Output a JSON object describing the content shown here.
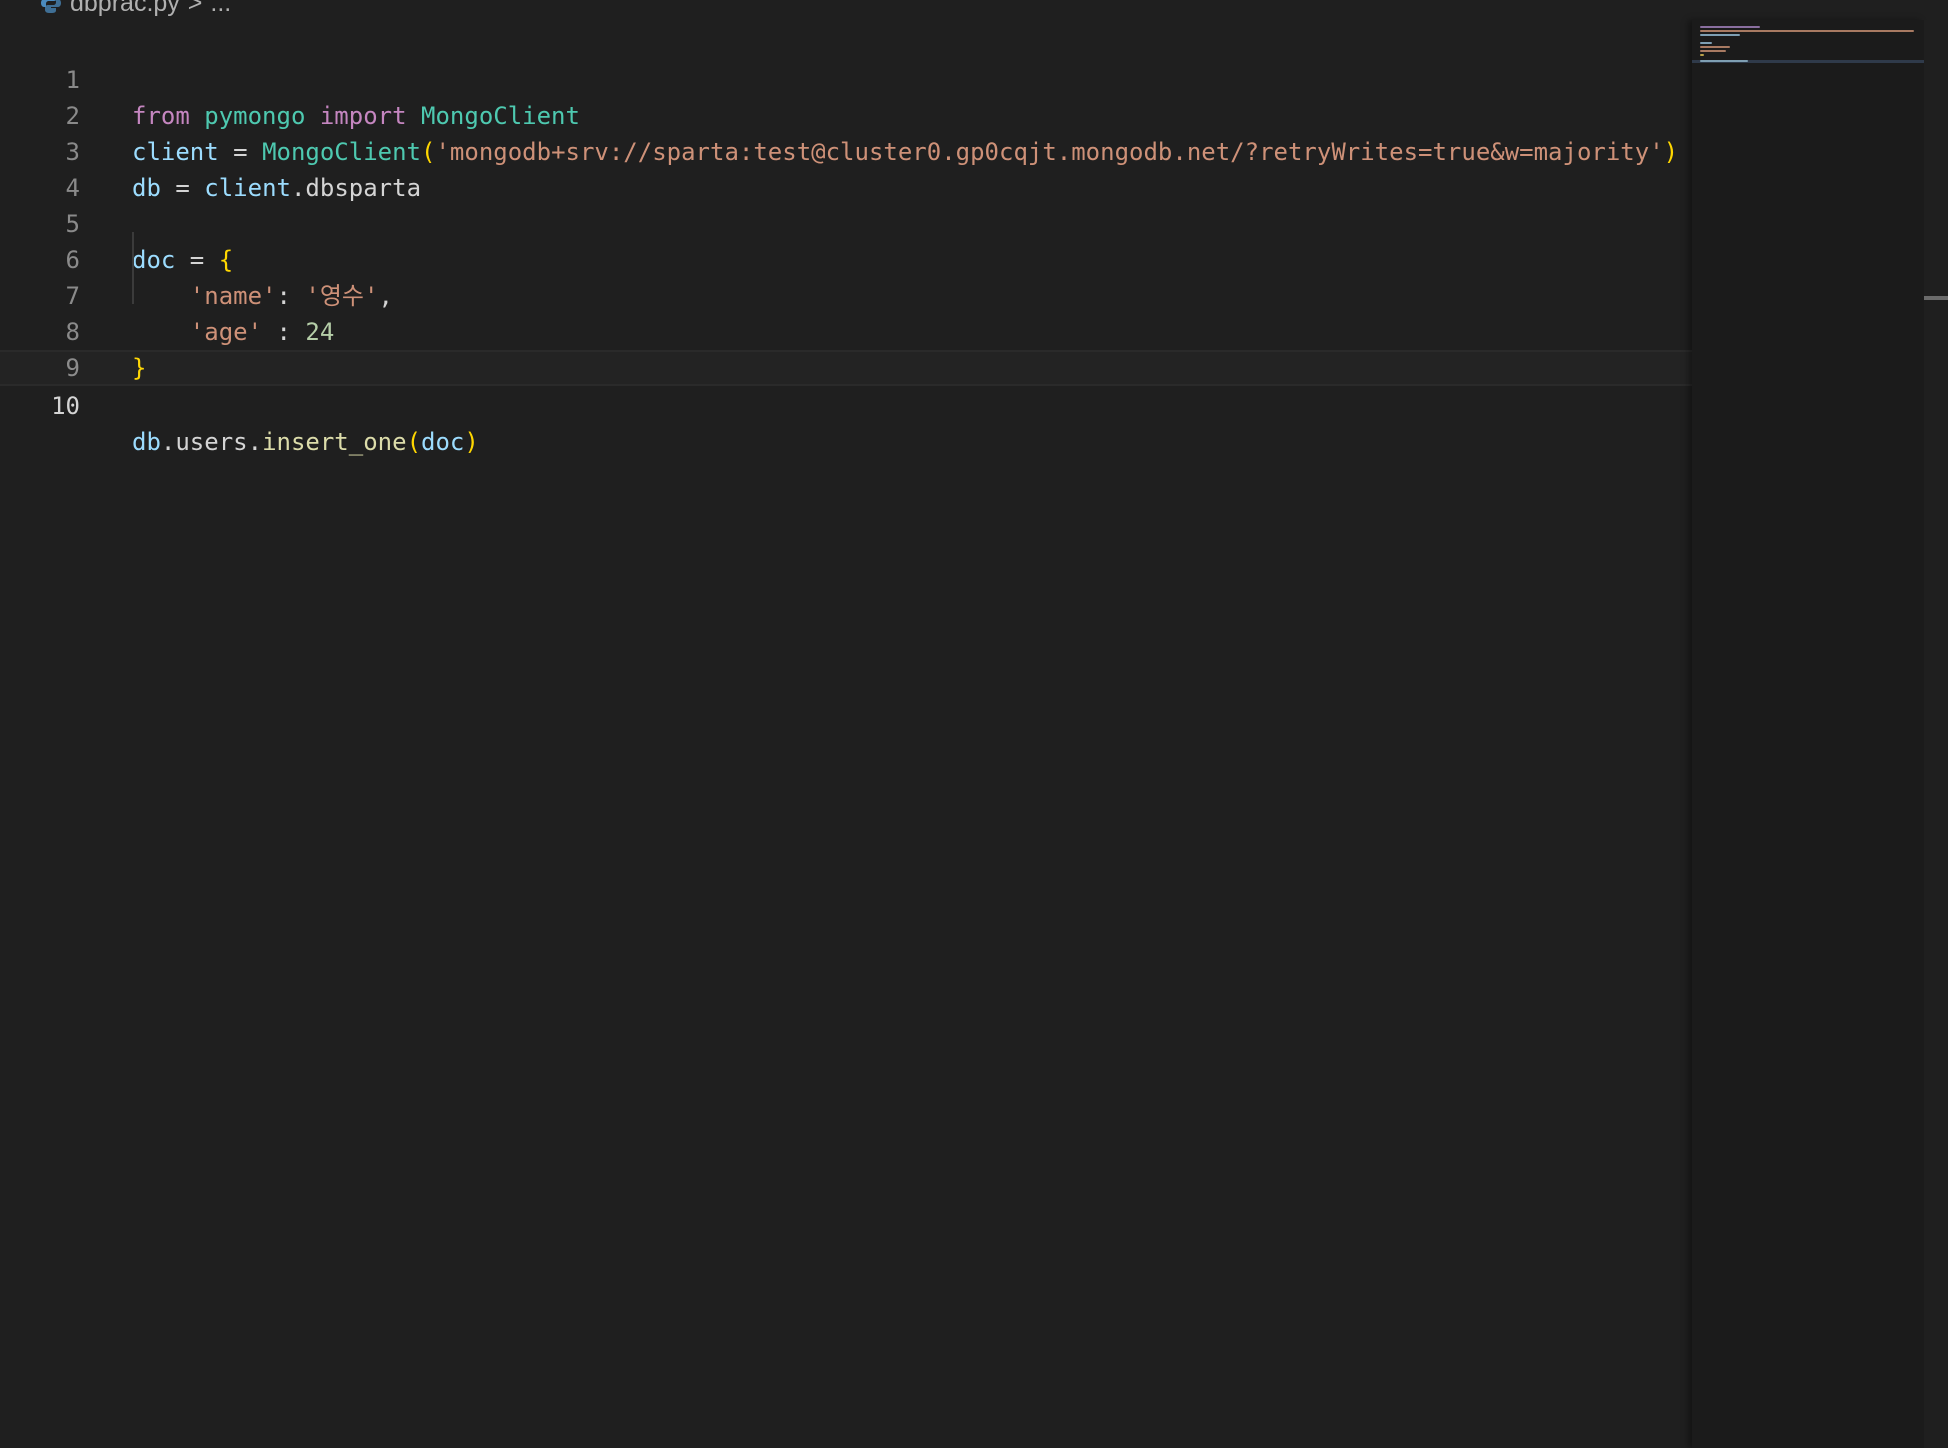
{
  "breadcrumb": {
    "file_name": "dbprac.py",
    "separator": ">",
    "ellipsis": "...",
    "icon": "python-file-icon"
  },
  "editor": {
    "current_line": 10,
    "lines": [
      {
        "number": "1",
        "tokens": [
          "from",
          " ",
          "pymongo",
          " ",
          "import",
          " ",
          "MongoClient"
        ]
      },
      {
        "number": "2",
        "tokens": [
          "client",
          " = ",
          "MongoClient",
          "(",
          "'mongodb+srv://sparta:test@cluster0.gp0cqjt.mongodb.net/?retryWrites=true&w=majority'",
          ")"
        ]
      },
      {
        "number": "3",
        "tokens": [
          "db",
          " = ",
          "client",
          ".",
          "dbsparta"
        ]
      },
      {
        "number": "4",
        "tokens": []
      },
      {
        "number": "5",
        "tokens": [
          "doc",
          " = ",
          "{"
        ]
      },
      {
        "number": "6",
        "tokens": [
          "    ",
          "'name'",
          ": ",
          "'영수'",
          ","
        ]
      },
      {
        "number": "7",
        "tokens": [
          "    ",
          "'age'",
          " : ",
          "24"
        ]
      },
      {
        "number": "8",
        "tokens": [
          "}"
        ]
      },
      {
        "number": "9",
        "tokens": []
      },
      {
        "number": "10",
        "tokens": [
          "db",
          ".",
          "users",
          ".",
          "insert_one",
          "(",
          "doc",
          ")"
        ]
      }
    ]
  },
  "colors": {
    "background": "#1f1f1f",
    "keyword": "#c586c0",
    "variable": "#9cdcfe",
    "class": "#4ec9b0",
    "function": "#dcdcaa",
    "string": "#ce9178",
    "number": "#b5cea8",
    "plain": "#d4d4d4",
    "brace": "#ffd700",
    "line_number": "#8a8a8a"
  }
}
